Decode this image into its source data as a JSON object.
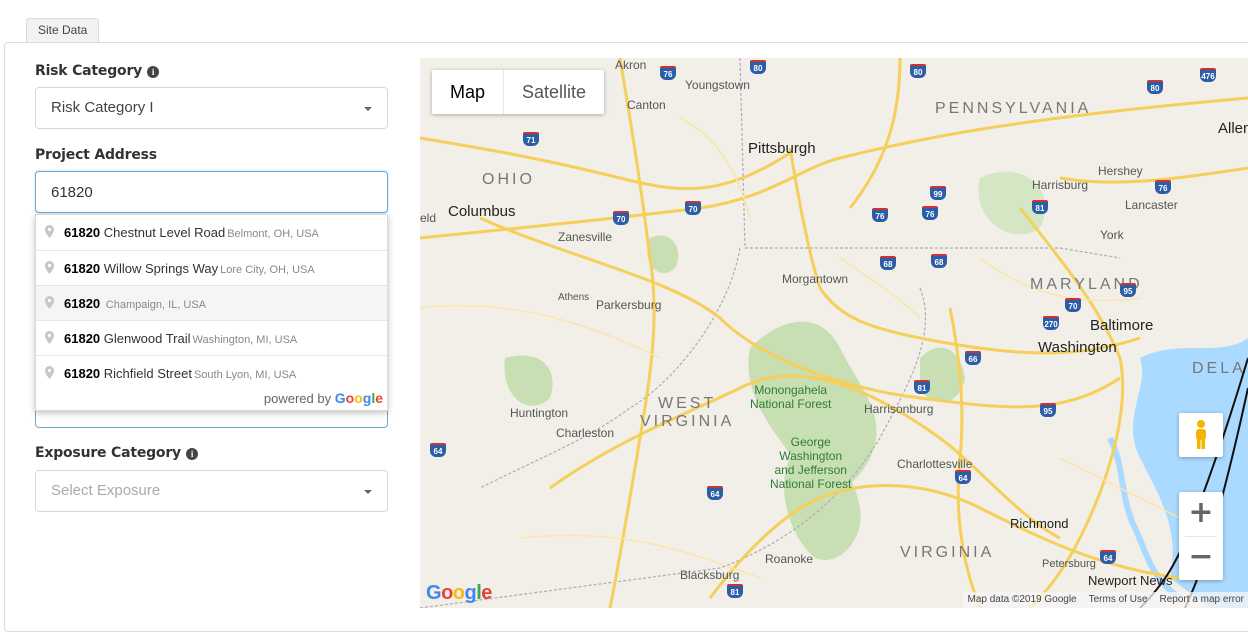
{
  "tab": {
    "label": "Site Data"
  },
  "risk_category": {
    "label": "Risk Category",
    "selected": "Risk Category I"
  },
  "project_address": {
    "label": "Project Address",
    "value": "61820"
  },
  "autocomplete": {
    "items": [
      {
        "match": "61820",
        "main": "Chestnut Level Road",
        "secondary": "Belmont, OH, USA"
      },
      {
        "match": "61820",
        "main": "Willow Springs Way",
        "secondary": "Lore City, OH, USA"
      },
      {
        "match": "61820",
        "main": "",
        "secondary": "Champaign, IL, USA"
      },
      {
        "match": "61820",
        "main": "Glenwood Trail",
        "secondary": "Washington, MI, USA"
      },
      {
        "match": "61820",
        "main": "Richfield Street",
        "secondary": "South Lyon, MI, USA"
      }
    ],
    "powered_by": "powered by",
    "google": "Google"
  },
  "exposure_category": {
    "label": "Exposure Category",
    "placeholder": "Select Exposure"
  },
  "map": {
    "type_buttons": [
      "Map",
      "Satellite"
    ],
    "logo": "Google",
    "attribution": [
      "Map data ©2019 Google",
      "Terms of Use",
      "Report a map error"
    ],
    "zoom_in": "+",
    "zoom_out": "−",
    "places": {
      "akron": "Akron",
      "youngstown": "Youngstown",
      "canton": "Canton",
      "pennsylvania": "PENNSYLVANIA",
      "allentown": "Allen",
      "pittsburgh": "Pittsburgh",
      "ohio": "OHIO",
      "harrisburg": "Harrisburg",
      "hershey": "Hershey",
      "columbus": "Columbus",
      "lancaster": "Lancaster",
      "zanesville": "Zanesville",
      "york": "York",
      "morgantown": "Morgantown",
      "maryland": "MARYLAND",
      "athens": "Athens",
      "parkersburg": "Parkersburg",
      "baltimore": "Baltimore",
      "washington": "Washington",
      "dela": "DELA",
      "monongahela": "Monongahela\nNational Forest",
      "westvirginia1": "WEST",
      "westvirginia2": "VIRGINIA",
      "huntington": "Huntington",
      "charleston": "Charleston",
      "harrisonburg": "Harrisonburg",
      "gw_forest": "George\nWashington\nand Jefferson\nNational Forest",
      "charlottesville": "Charlottesville",
      "richmond": "Richmond",
      "virginia": "VIRGINIA",
      "roanoke": "Roanoke",
      "petersburg": "Petersburg",
      "blacksburg": "Blacksburg",
      "newportnews": "Newport News",
      "eld": "eld"
    }
  },
  "colors": {
    "input_focus": "#6aa9d8",
    "map_land": "#f1efe8",
    "map_forest": "#c8dfb4",
    "map_road": "#f6cf5a",
    "map_water": "#aadaff"
  }
}
